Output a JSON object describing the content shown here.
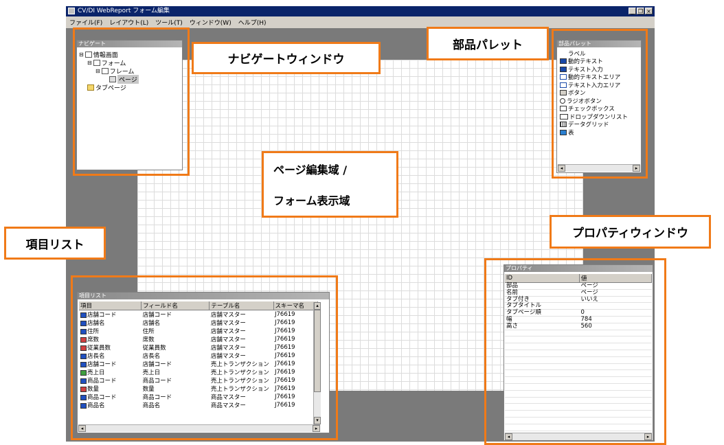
{
  "window": {
    "title": "CV/DI WebReport フォーム編集",
    "buttons": [
      "_",
      "❐",
      "×"
    ]
  },
  "menu": [
    "ファイル(F)",
    "レイアウト(L)",
    "ツール(T)",
    "ウィンドウ(W)",
    "ヘルプ(H)"
  ],
  "navigator": {
    "title": "ナビゲート",
    "tree": [
      "情報画面",
      "フォーム",
      "フレーム",
      "ページ",
      "タブページ"
    ]
  },
  "palette": {
    "title": "部品パレット",
    "items": [
      {
        "icon": "ab",
        "label": "ラベル"
      },
      {
        "icon": "abl",
        "label": "動的テキスト"
      },
      {
        "icon": "abl",
        "label": "テキスト入力"
      },
      {
        "icon": "area",
        "label": "動的テキストエリア"
      },
      {
        "icon": "area",
        "label": "テキスト入力エリア"
      },
      {
        "icon": "btn",
        "label": "ボタン"
      },
      {
        "icon": "radio",
        "label": "ラジオボタン"
      },
      {
        "icon": "check",
        "label": "チェックボックス"
      },
      {
        "icon": "combo",
        "label": "ドロップダウンリスト"
      },
      {
        "icon": "grid",
        "label": "データグリッド"
      },
      {
        "icon": "table",
        "label": "表"
      }
    ]
  },
  "fieldlist": {
    "title": "項目リスト",
    "columns": [
      "項目",
      "フィールド名",
      "テーブル名",
      "スキーマ名"
    ],
    "rows": [
      {
        "icon": "ab",
        "item": "店舗コード",
        "field": "店舗コード",
        "table": "店舗マスター",
        "schema": "J76619"
      },
      {
        "icon": "ab",
        "item": "店舗名",
        "field": "店舗名",
        "table": "店舗マスター",
        "schema": "J76619"
      },
      {
        "icon": "ab",
        "item": "住所",
        "field": "住所",
        "table": "店舗マスター",
        "schema": "J76619"
      },
      {
        "icon": "num",
        "item": "席数",
        "field": "席数",
        "table": "店舗マスター",
        "schema": "J76619"
      },
      {
        "icon": "num",
        "item": "従業員数",
        "field": "従業員数",
        "table": "店舗マスター",
        "schema": "J76619"
      },
      {
        "icon": "ab",
        "item": "店長名",
        "field": "店長名",
        "table": "店舗マスター",
        "schema": "J76619"
      },
      {
        "icon": "ab",
        "item": "店舗コード",
        "field": "店舗コード",
        "table": "売上トランザクション",
        "schema": "J76619"
      },
      {
        "icon": "date",
        "item": "売上日",
        "field": "売上日",
        "table": "売上トランザクション",
        "schema": "J76619"
      },
      {
        "icon": "ab",
        "item": "商品コード",
        "field": "商品コード",
        "table": "売上トランザクション",
        "schema": "J76619"
      },
      {
        "icon": "num",
        "item": "数量",
        "field": "数量",
        "table": "売上トランザクション",
        "schema": "J76619"
      },
      {
        "icon": "ab",
        "item": "商品コード",
        "field": "商品コード",
        "table": "商品マスター",
        "schema": "J76619"
      },
      {
        "icon": "ab",
        "item": "商品名",
        "field": "商品名",
        "table": "商品マスター",
        "schema": "J76619"
      }
    ]
  },
  "properties": {
    "title": "プロパティ",
    "columns": [
      "ID",
      "値"
    ],
    "rows": [
      {
        "id": "部品",
        "value": "ページ"
      },
      {
        "id": "名前",
        "value": "ページ"
      },
      {
        "id": "タブ付き",
        "value": "いいえ"
      },
      {
        "id": "タブタイトル",
        "value": ""
      },
      {
        "id": "タブページ順",
        "value": "0"
      },
      {
        "id": "幅",
        "value": "784"
      },
      {
        "id": "高さ",
        "value": "560"
      }
    ]
  },
  "callouts": {
    "navigator": "ナビゲートウィンドウ",
    "palette": "部品パレット",
    "editor_line1": "ページ編集域 /",
    "editor_line2": "フォーム表示域",
    "fieldlist": "項目リスト",
    "properties": "プロパティウィンドウ"
  },
  "colors": {
    "callout_border": "#f07a18",
    "titlebar": "#0a246a",
    "workspace": "#7a7a7a"
  }
}
